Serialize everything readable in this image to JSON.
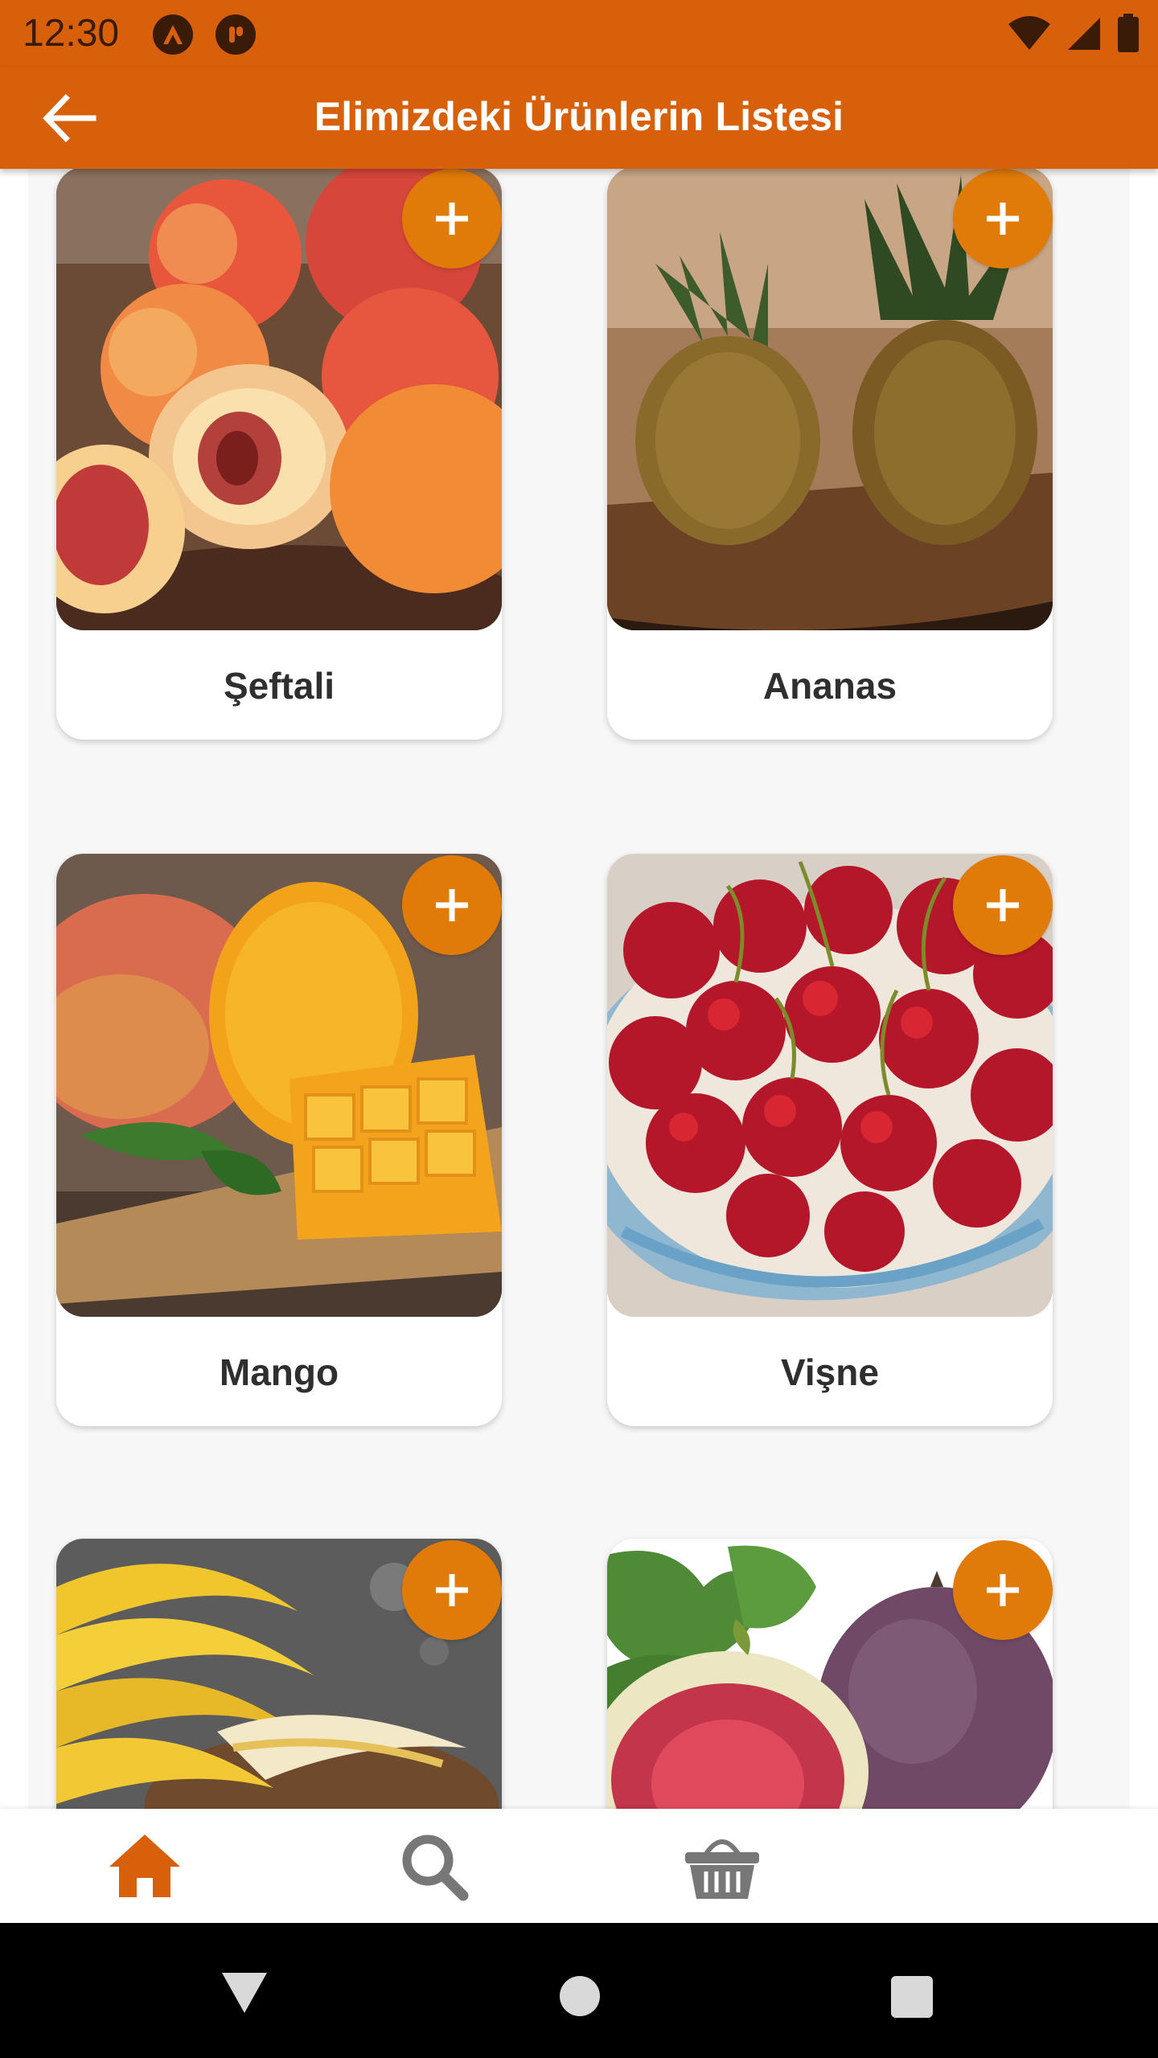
{
  "status_bar": {
    "time": "12:30",
    "left_icons": [
      "notification-a-icon",
      "notification-b-icon"
    ],
    "right_icons": [
      "wifi-icon",
      "signal-icon",
      "battery-icon"
    ]
  },
  "app_bar": {
    "title": "Elimizdeki Ürünlerin Listesi",
    "back_icon": "arrow-left-icon"
  },
  "products": [
    {
      "name": "Şeftali",
      "image": "peaches"
    },
    {
      "name": "Ananas",
      "image": "pineapples"
    },
    {
      "name": "Mango",
      "image": "mangoes"
    },
    {
      "name": "Vişne",
      "image": "sour-cherries"
    },
    {
      "name": "",
      "image": "bananas"
    },
    {
      "name": "",
      "image": "figs"
    }
  ],
  "add_button_icon": "plus-icon",
  "bottom_nav": {
    "items": [
      {
        "icon": "home-icon",
        "active": true
      },
      {
        "icon": "search-icon",
        "active": false
      },
      {
        "icon": "basket-icon",
        "active": false
      }
    ],
    "active_color": "#D9600A",
    "inactive_color": "#777777"
  },
  "colors": {
    "primary": "#D9600A",
    "accent": "#E07A08",
    "background": "#F7F7F7"
  }
}
